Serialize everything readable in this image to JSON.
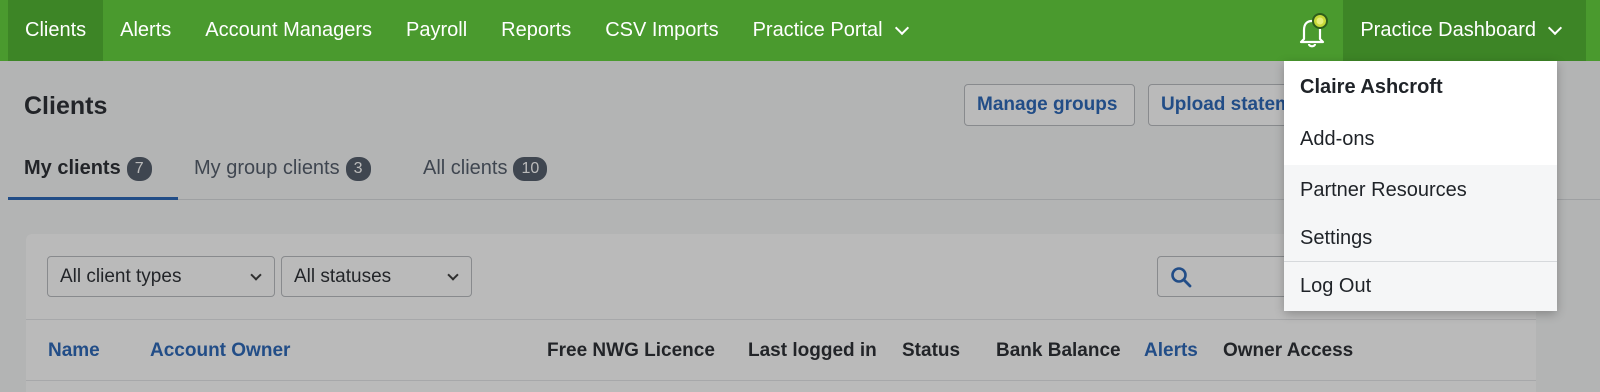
{
  "nav": {
    "items": [
      {
        "label": "Clients"
      },
      {
        "label": "Alerts"
      },
      {
        "label": "Account Managers"
      },
      {
        "label": "Payroll"
      },
      {
        "label": "Reports"
      },
      {
        "label": "CSV Imports"
      },
      {
        "label": "Practice Portal"
      }
    ],
    "dashboard_label": "Practice Dashboard"
  },
  "page": {
    "title": "Clients",
    "manage_groups_label": "Manage groups",
    "upload_label": "Upload statements"
  },
  "tabs": [
    {
      "label": "My clients",
      "count": "7"
    },
    {
      "label": "My group clients",
      "count": "3"
    },
    {
      "label": "All clients",
      "count": "10"
    }
  ],
  "filters": {
    "client_type": "All client types",
    "status": "All statuses"
  },
  "table": {
    "headers": [
      "Name",
      "Account Owner",
      "Free NWG Licence",
      "Last logged in",
      "Status",
      "Bank Balance",
      "Alerts",
      "Owner Access"
    ]
  },
  "dropdown": {
    "user_name": "Claire Ashcroft",
    "items": [
      {
        "label": "Add-ons"
      },
      {
        "label": "Partner Resources"
      },
      {
        "label": "Settings"
      },
      {
        "label": "Log Out"
      }
    ]
  },
  "colors": {
    "nav_bg": "#4a9a2e",
    "link": "#1f5fb4"
  }
}
